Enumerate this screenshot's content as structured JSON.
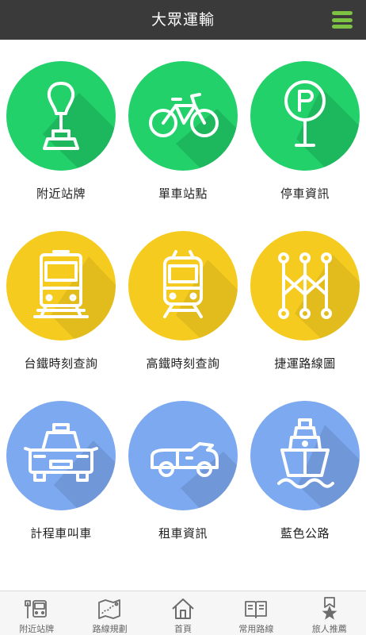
{
  "header": {
    "title": "大眾運輸",
    "menu_icon": "hamburger-menu-icon",
    "menu_color": "#7dc242",
    "background": "#3a3a3a"
  },
  "colors": {
    "green": "#22d16a",
    "yellow": "#f6cb1f",
    "blue": "#7da9f0"
  },
  "tiles": [
    {
      "label": "附近站牌",
      "icon": "bus-stop-sign-icon",
      "color": "#22d16a"
    },
    {
      "label": "單車站點",
      "icon": "bicycle-icon",
      "color": "#22d16a"
    },
    {
      "label": "停車資訊",
      "icon": "parking-sign-icon",
      "color": "#22d16a"
    },
    {
      "label": "台鐵時刻查詢",
      "icon": "train-icon",
      "color": "#f6cb1f"
    },
    {
      "label": "高鐵時刻查詢",
      "icon": "high-speed-rail-icon",
      "color": "#f6cb1f"
    },
    {
      "label": "捷運路線圖",
      "icon": "metro-map-icon",
      "color": "#f6cb1f"
    },
    {
      "label": "計程車叫車",
      "icon": "taxi-icon",
      "color": "#7da9f0"
    },
    {
      "label": "租車資訊",
      "icon": "convertible-car-icon",
      "color": "#7da9f0"
    },
    {
      "label": "藍色公路",
      "icon": "ship-icon",
      "color": "#7da9f0"
    }
  ],
  "tabbar": {
    "items": [
      {
        "label": "附近站牌",
        "icon": "bus-stop-icon"
      },
      {
        "label": "路線規劃",
        "icon": "route-map-icon"
      },
      {
        "label": "首頁",
        "icon": "home-icon"
      },
      {
        "label": "常用路線",
        "icon": "book-icon"
      },
      {
        "label": "旅人推薦",
        "icon": "star-bookmark-icon"
      }
    ]
  }
}
